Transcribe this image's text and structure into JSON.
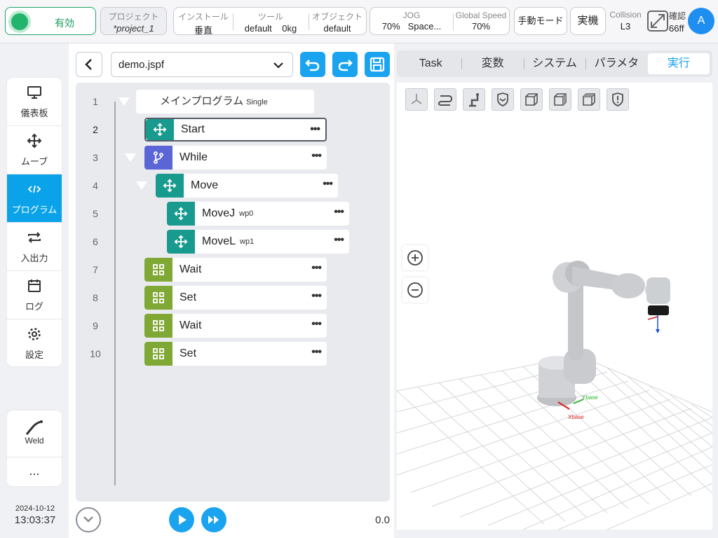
{
  "topbar": {
    "enable_label": "有効",
    "project_label": "プロジェクト",
    "project_value": "*project_1",
    "install_label": "インストール",
    "install_value": "垂直",
    "tool_label": "ツール",
    "tool_name": "default",
    "tool_weight": "0kg",
    "object_label": "オブジェクト",
    "object_value": "default",
    "jog_label": "JOG",
    "jog_value": "70%",
    "jog_mode": "Space...",
    "global_speed_label": "Global Speed",
    "global_speed_value": "70%",
    "manual_mode": "手動モード",
    "real_machine": "実機",
    "collision_label": "Collision",
    "collision_value": "L3",
    "confirm_label": "確認",
    "confirm_value": "66ff",
    "avatar_letter": "A"
  },
  "nav": {
    "items": [
      {
        "label": "儀表板",
        "icon": "monitor-icon"
      },
      {
        "label": "ムーブ",
        "icon": "move-icon"
      },
      {
        "label": "プログラム",
        "icon": "code-icon",
        "active": true
      },
      {
        "label": "入出力",
        "icon": "io-icon"
      },
      {
        "label": "ログ",
        "icon": "calendar-icon"
      },
      {
        "label": "設定",
        "icon": "gear-icon"
      }
    ],
    "weld_label": "Weld",
    "more_label": "..."
  },
  "datetime": {
    "date": "2024-10-12",
    "time": "13:03:37"
  },
  "program": {
    "file": "demo.jspf",
    "main_label": "メインプログラム",
    "main_sub": "Single",
    "rows": [
      {
        "line": "1"
      },
      {
        "line": "2",
        "label": "Start"
      },
      {
        "line": "3",
        "label": "While"
      },
      {
        "line": "4",
        "label": "Move"
      },
      {
        "line": "5",
        "label": "MoveJ",
        "sub": "wp0"
      },
      {
        "line": "6",
        "label": "MoveL",
        "sub": "wp1"
      },
      {
        "line": "7",
        "label": "Wait"
      },
      {
        "line": "8",
        "label": "Set"
      },
      {
        "line": "9",
        "label": "Wait"
      },
      {
        "line": "10",
        "label": "Set"
      }
    ],
    "speed_value": "0.0"
  },
  "tabs": [
    "Task",
    "変数",
    "システム",
    "パラメタ",
    "実行"
  ],
  "viewport": {
    "x_axis_label": "Xbase",
    "y_axis_label": "Ybase"
  },
  "colors": {
    "accent": "#1aa3ef",
    "enable": "#22b46c",
    "teal": "#199a8e",
    "purple": "#5b66d6",
    "olive": "#7fa934"
  }
}
